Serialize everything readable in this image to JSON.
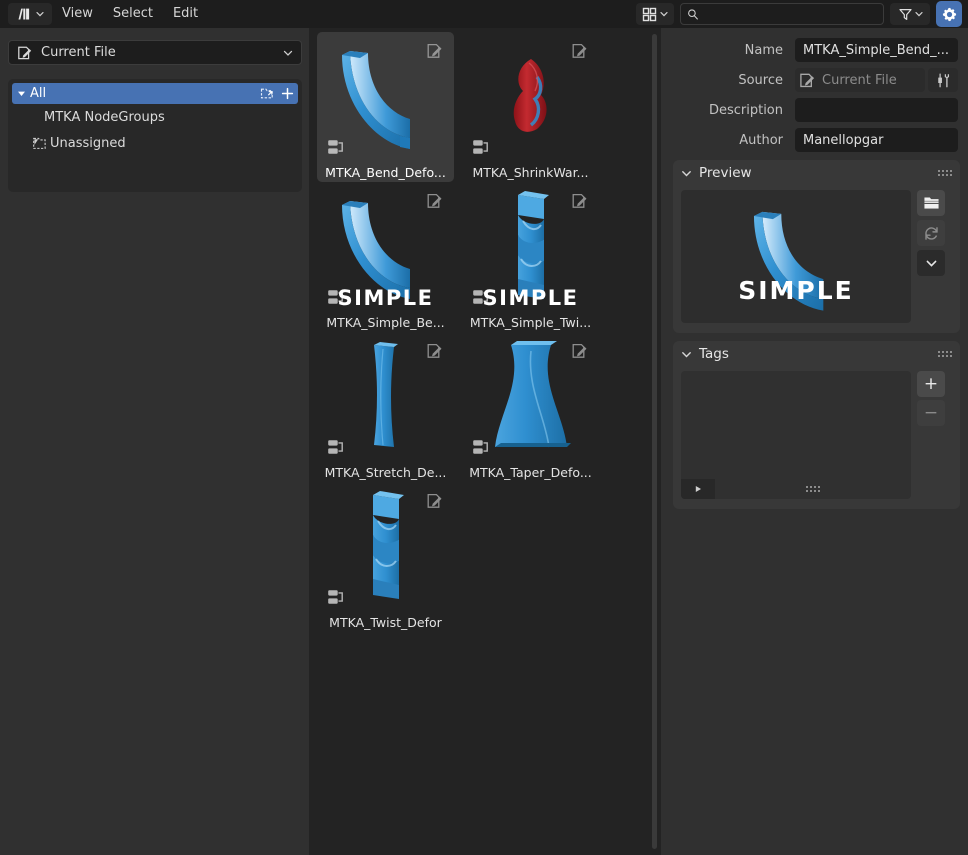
{
  "window": {
    "title": "Blender Asset Browser"
  },
  "header": {
    "editor_type_icon": "asset-browser-icon",
    "menus": [
      {
        "label": "View"
      },
      {
        "label": "Select"
      },
      {
        "label": "Edit"
      }
    ],
    "display_mode_icon": "grid-view-icon",
    "search": {
      "value": "",
      "placeholder": ""
    },
    "filter_icon": "funnel-icon",
    "settings_icon": "gear-icon",
    "settings_active_color": "#4772b3"
  },
  "left_panel": {
    "library_dropdown": {
      "label": "Current File",
      "icon": "current-file-icon"
    },
    "catalogs": [
      {
        "label": "All",
        "selected": true,
        "has_triangle": true,
        "icon": null
      },
      {
        "label": "MTKA NodeGroups",
        "selected": false,
        "has_triangle": false,
        "icon": null
      },
      {
        "label": "Unassigned",
        "selected": false,
        "has_triangle": false,
        "icon": "unassigned-icon"
      }
    ],
    "catalog_actions": {
      "import_icon": "catalog-import-icon",
      "add_icon": "plus-icon"
    }
  },
  "asset_grid": {
    "assets": [
      {
        "name": "MTKA_Bend_Defo...",
        "selected": true,
        "shape": "bend",
        "color": "#2f8fd0",
        "overlay_text": ""
      },
      {
        "name": "MTKA_ShrinkWar...",
        "selected": false,
        "shape": "shrink",
        "color": "#b01f24",
        "overlay_text": ""
      },
      {
        "name": "MTKA_Simple_Be...",
        "selected": false,
        "shape": "bend",
        "color": "#2f8fd0",
        "overlay_text": "SIMPLE"
      },
      {
        "name": "MTKA_Simple_Twi...",
        "selected": false,
        "shape": "twist",
        "color": "#2f8fd0",
        "overlay_text": "SIMPLE"
      },
      {
        "name": "MTKA_Stretch_De...",
        "selected": false,
        "shape": "stretch",
        "color": "#2f8fd0",
        "overlay_text": ""
      },
      {
        "name": "MTKA_Taper_Defo...",
        "selected": false,
        "shape": "taper",
        "color": "#2f8fd0",
        "overlay_text": ""
      },
      {
        "name": "MTKA_Twist_Defor",
        "selected": false,
        "shape": "twist",
        "color": "#2f8fd0",
        "overlay_text": ""
      }
    ],
    "badge_edit_icon": "edit-asset-icon",
    "badge_type_icon": "node-group-icon"
  },
  "right_panel": {
    "properties": [
      {
        "label": "Name",
        "value": "MTKA_Simple_Bend_...",
        "disabled": false,
        "icon": null,
        "has_tool": false
      },
      {
        "label": "Source",
        "value": "Current File",
        "disabled": true,
        "icon": "current-file-icon",
        "has_tool": true
      },
      {
        "label": "Description",
        "value": "",
        "disabled": false,
        "icon": null,
        "has_tool": false
      },
      {
        "label": "Author",
        "value": "Manellopgar",
        "disabled": false,
        "icon": null,
        "has_tool": false
      }
    ],
    "source_tool_icon": "wrench-screwdriver-icon",
    "preview_panel": {
      "title": "Preview",
      "collapse_icon": "chevron-down-icon",
      "grip_icon": "grip-dots-icon",
      "image_overlay_text": "SIMPLE",
      "image_shape": "bend",
      "image_color": "#2f8fd0",
      "buttons": [
        {
          "name": "load-custom-preview-button",
          "icon": "folder-icon",
          "state": "enabled"
        },
        {
          "name": "regenerate-preview-button",
          "icon": "refresh-icon",
          "state": "dimmed"
        },
        {
          "name": "preview-dropdown-button",
          "icon": "chevron-down-icon",
          "state": "dark"
        }
      ]
    },
    "tags_panel": {
      "title": "Tags",
      "collapse_icon": "chevron-down-icon",
      "grip_icon": "grip-dots-icon",
      "tags": [],
      "add_label": "+",
      "remove_label": "−",
      "expand_icon": "triangle-right-icon",
      "resize_grip_icon": "grip-dots-icon"
    }
  }
}
